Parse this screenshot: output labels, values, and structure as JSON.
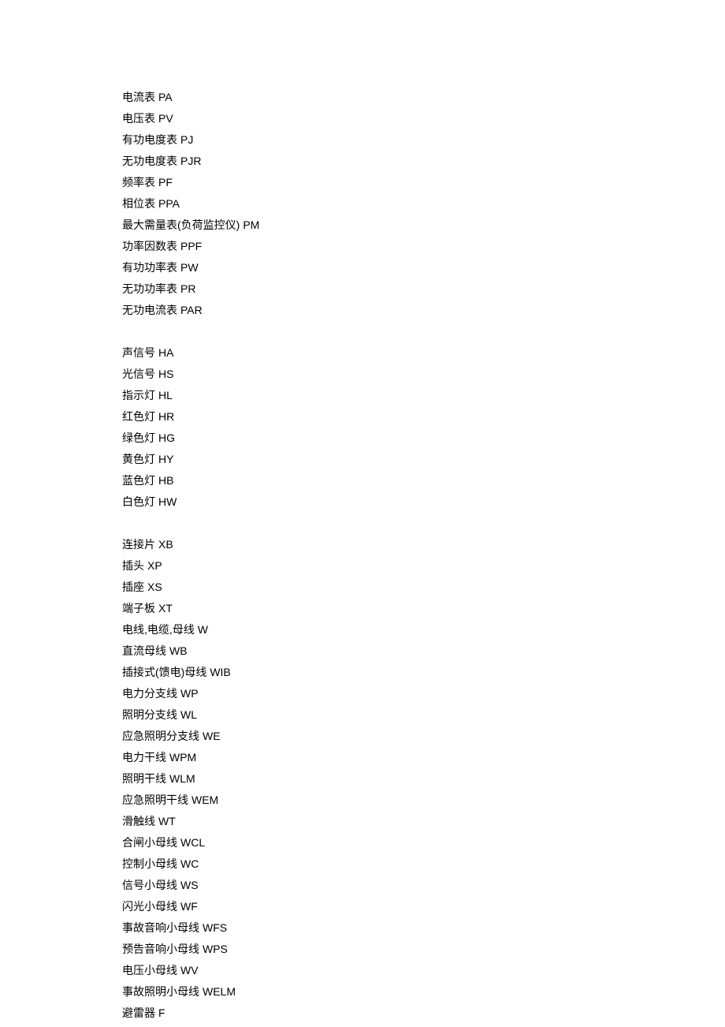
{
  "groups": [
    [
      {
        "name": "电流表",
        "code": "PA"
      },
      {
        "name": "电压表",
        "code": "PV"
      },
      {
        "name": "有功电度表",
        "code": "PJ"
      },
      {
        "name": "无功电度表",
        "code": "PJR"
      },
      {
        "name": "频率表",
        "code": "PF"
      },
      {
        "name": "相位表",
        "code": "PPA"
      },
      {
        "name": "最大需量表(负荷监控仪)",
        "code": "PM"
      },
      {
        "name": "功率因数表",
        "code": "PPF"
      },
      {
        "name": "有功功率表",
        "code": "PW"
      },
      {
        "name": "无功功率表",
        "code": "PR"
      },
      {
        "name": "无功电流表",
        "code": "PAR"
      }
    ],
    [
      {
        "name": "声信号",
        "code": "HA"
      },
      {
        "name": "光信号",
        "code": "HS"
      },
      {
        "name": "指示灯",
        "code": "HL"
      },
      {
        "name": "红色灯",
        "code": "HR"
      },
      {
        "name": "绿色灯",
        "code": "HG"
      },
      {
        "name": "黄色灯",
        "code": "HY"
      },
      {
        "name": "蓝色灯",
        "code": "HB"
      },
      {
        "name": "白色灯",
        "code": "HW"
      }
    ],
    [
      {
        "name": "连接片",
        "code": "XB"
      },
      {
        "name": "插头",
        "code": "XP"
      },
      {
        "name": "插座",
        "code": "XS"
      },
      {
        "name": "端子板",
        "code": "XT"
      },
      {
        "name": "电线,电缆,母线",
        "code": "W"
      },
      {
        "name": "直流母线",
        "code": "WB"
      },
      {
        "name": "插接式(馈电)母线",
        "code": "WIB"
      },
      {
        "name": "电力分支线",
        "code": "WP"
      },
      {
        "name": "照明分支线",
        "code": "WL"
      },
      {
        "name": "应急照明分支线",
        "code": "WE"
      },
      {
        "name": "电力干线",
        "code": "WPM"
      },
      {
        "name": "照明干线",
        "code": "WLM"
      },
      {
        "name": "应急照明干线",
        "code": "WEM"
      },
      {
        "name": "滑触线",
        "code": "WT"
      },
      {
        "name": "合闸小母线",
        "code": "WCL"
      },
      {
        "name": "控制小母线",
        "code": "WC"
      },
      {
        "name": "信号小母线",
        "code": "WS"
      },
      {
        "name": "闪光小母线",
        "code": "WF"
      },
      {
        "name": "事故音响小母线",
        "code": "WFS"
      },
      {
        "name": "预告音响小母线",
        "code": "WPS"
      },
      {
        "name": "电压小母线",
        "code": "WV"
      },
      {
        "name": "事故照明小母线",
        "code": "WELM"
      },
      {
        "name": "避雷器",
        "code": "F"
      }
    ]
  ]
}
